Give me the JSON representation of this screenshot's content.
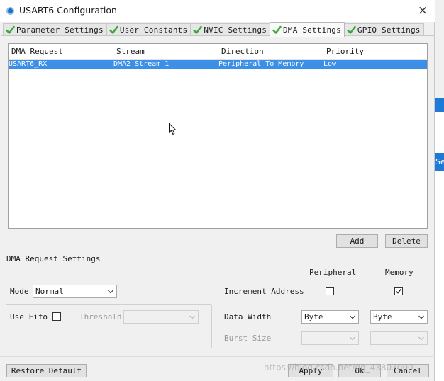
{
  "window": {
    "title": "USART6 Configuration",
    "close_symbol": "×",
    "accent_color": "#3b8fe6",
    "check_color": "#3aa63a"
  },
  "tabs": [
    {
      "label": "Parameter Settings",
      "icon": "green-check-icon",
      "active": false
    },
    {
      "label": "User Constants",
      "icon": "green-check-icon",
      "active": false
    },
    {
      "label": "NVIC Settings",
      "icon": "green-check-icon",
      "active": false
    },
    {
      "label": "DMA Settings",
      "icon": "green-check-icon",
      "active": true
    },
    {
      "label": "GPIO Settings",
      "icon": "green-check-icon",
      "active": false
    }
  ],
  "table": {
    "columns": [
      "DMA Request",
      "Stream",
      "Direction",
      "Priority"
    ],
    "rows": [
      {
        "request": "USART6_RX",
        "stream": "DMA2 Stream 1",
        "direction": "Peripheral To Memory",
        "priority": "Low",
        "selected": true
      }
    ]
  },
  "buttons": {
    "add": "Add",
    "delete": "Delete",
    "restore_default": "Restore Default",
    "apply": "Apply",
    "ok": "Ok",
    "cancel": "Cancel"
  },
  "settings": {
    "section_title": "DMA Request Settings",
    "peripheral_header": "Peripheral",
    "memory_header": "Memory",
    "mode_label": "Mode",
    "mode_value": "Normal",
    "increment_address_label": "Increment Address",
    "increment_peripheral_checked": false,
    "increment_memory_checked": true,
    "use_fifo_label": "Use Fifo",
    "use_fifo_checked": false,
    "threshold_label": "Threshold",
    "threshold_value": "",
    "data_width_label": "Data Width",
    "data_width_peripheral": "Byte",
    "data_width_memory": "Byte",
    "burst_size_label": "Burst Size",
    "burst_size_peripheral": "",
    "burst_size_memory": ""
  },
  "background_window": {
    "partial_text": "Se"
  },
  "watermark": "https://blog.csdn.net/qq_43803000"
}
